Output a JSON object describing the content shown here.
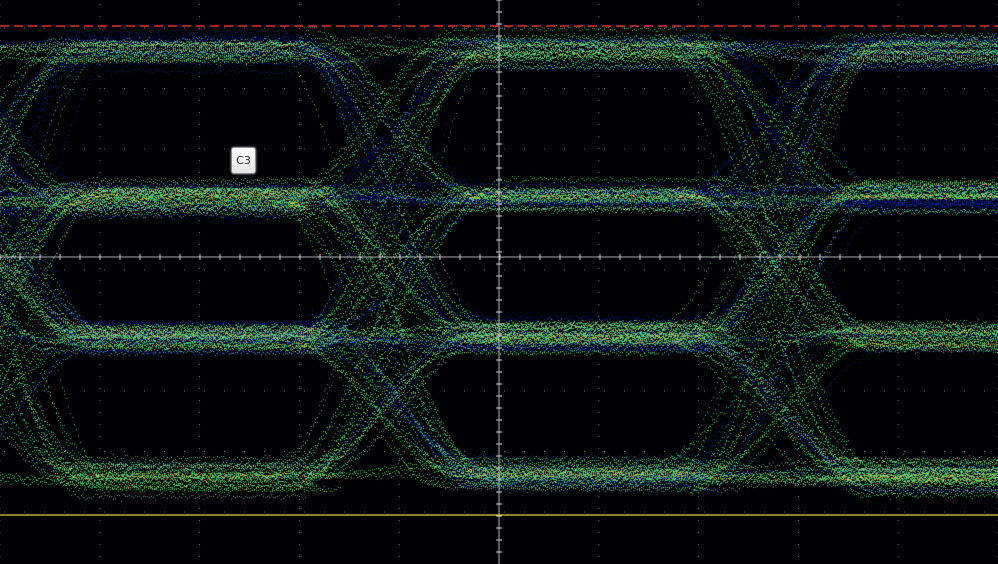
{
  "scope": {
    "channel_label": "C3",
    "channel_label_color": "#333333",
    "trace_palette": [
      "#0a1a8c",
      "#1c5fd0",
      "#20b6c8",
      "#43c86a",
      "#c8d845",
      "#f0c030",
      "#f05060",
      "#ffe680"
    ],
    "background_color": "#000005",
    "graticule_color": "#d0d0d0",
    "upper_cursor_color": "#e0303a",
    "lower_cursor_color": "#e0d030",
    "eye_levels": 4,
    "unit_intervals_shown": 3
  }
}
